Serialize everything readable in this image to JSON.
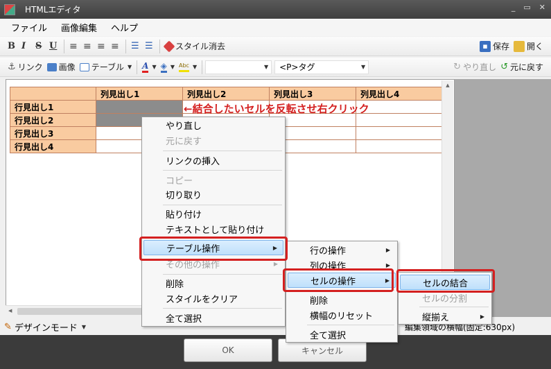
{
  "window": {
    "title": "HTMLエディタ",
    "controls": [
      "_",
      "▭",
      "✕"
    ]
  },
  "menubar": [
    "ファイル",
    "画像編集",
    "ヘルプ"
  ],
  "toolbar1": {
    "format": [
      "B",
      "I",
      "S",
      "U"
    ],
    "clear_style": "スタイル消去",
    "save": "保存",
    "open": "開く"
  },
  "toolbar2": {
    "link": "リンク",
    "image": "画像",
    "table": "テーブル",
    "tag_combo": "<P>タグ",
    "redo": "やり直し",
    "undo": "元に戻す"
  },
  "table": {
    "headers": [
      "",
      "列見出し1",
      "列見出し2",
      "列見出し3",
      "列見出し4"
    ],
    "rows": [
      "行見出し1",
      "行見出し2",
      "行見出し3",
      "行見出し4"
    ]
  },
  "annotation": "←結合したいセルを反転させ右クリック",
  "context_menu": {
    "items": [
      "やり直し",
      "元に戻す",
      "リンクの挿入",
      "コピー",
      "切り取り",
      "貼り付け",
      "テキストとして貼り付け",
      "テーブル操作",
      "その他の操作",
      "削除",
      "スタイルをクリア",
      "全て選択"
    ]
  },
  "table_submenu": {
    "items": [
      "行の操作",
      "列の操作",
      "セルの操作",
      "削除",
      "横幅のリセット",
      "全て選択"
    ]
  },
  "cell_submenu": {
    "items": [
      "セルの結合",
      "セルの分割",
      "縦揃え"
    ]
  },
  "status": {
    "design_mode": "デザインモード",
    "width_info": "編集領域の横幅(固定:630px)"
  },
  "buttons": {
    "ok": "OK",
    "cancel": "キャンセル"
  },
  "colors": {
    "accent_red": "#d42020",
    "header_fill": "#f9cba0",
    "selected_cell": "#8c8c8c"
  }
}
